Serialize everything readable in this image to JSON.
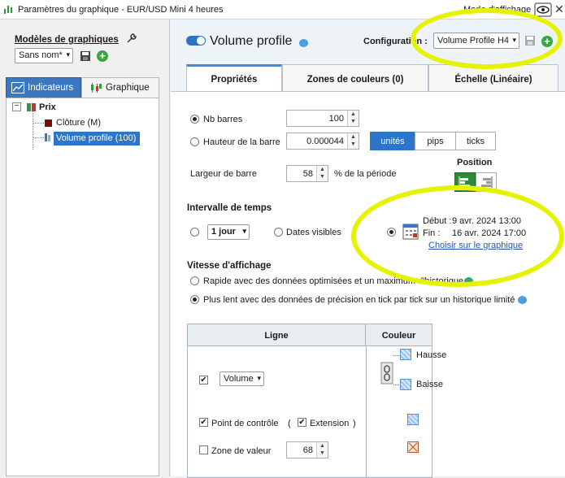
{
  "window": {
    "title": "Paramètres du graphique - EUR/USD Mini 4 heures",
    "display_mode": "Mode d'affichage",
    "close_glyph": "✕"
  },
  "left": {
    "models_label": "Modèles de graphiques",
    "models_value": "Sans nom*",
    "tabs": [
      "Indicateurs",
      "Graphique"
    ],
    "tree": {
      "expander": "−",
      "root": "Prix",
      "children": [
        "Clôture (M)",
        "Volume profile (100)"
      ],
      "child_colors": [
        "#7a0c0c",
        "#3c78c0"
      ]
    }
  },
  "right": {
    "title": "Volume profile",
    "config_label": "Configuration :",
    "config_value": "Volume Profile H4",
    "tabs": [
      "Propriétés",
      "Zones de couleurs (0)",
      "Échelle (Linéaire)"
    ],
    "props": {
      "nb_barres_label": "Nb barres",
      "nb_barres_value": "100",
      "hauteur_label": "Hauteur de la barre",
      "hauteur_value": "0.000044",
      "units": [
        "unités",
        "pips",
        "ticks"
      ],
      "largeur_label": "Largeur de barre",
      "largeur_value": "58",
      "largeur_suffix": "% de la période",
      "position_label": "Position",
      "intervalle_label": "Intervalle de temps",
      "intervalle_value": "1 jour",
      "dates_visibles": "Dates visibles",
      "debut_label": "Début :",
      "debut_value": "9 avr. 2024 13:00",
      "fin_label": "Fin :",
      "fin_value": "16 avr. 2024 17:00",
      "choisir_link": "Choisir sur le graphique",
      "vitesse_label": "Vitesse d'affichage",
      "vitesse_opt1": "Rapide avec des données optimisées et un maximum d'historique",
      "vitesse_opt2": "Plus lent avec des données de précision en tick par tick sur un historique limité"
    },
    "table": {
      "col_ligne": "Ligne",
      "col_couleur": "Couleur",
      "volume_value": "Volume",
      "point_controle": "Point de contrôle",
      "paren_open": "(",
      "paren_close": ")",
      "extension": "Extension",
      "zone_valeur": "Zone de valeur",
      "zone_value": "68",
      "hausse": "Hausse",
      "baisse": "Baisse"
    }
  },
  "glyphs": {
    "caret": "▾",
    "spin_up": "▲",
    "spin_down": "▼",
    "check": "✔",
    "plus": "+"
  },
  "colors": {
    "accent": "#2e74c8",
    "highlight": "#e5f200",
    "add_green": "#3aa640"
  }
}
